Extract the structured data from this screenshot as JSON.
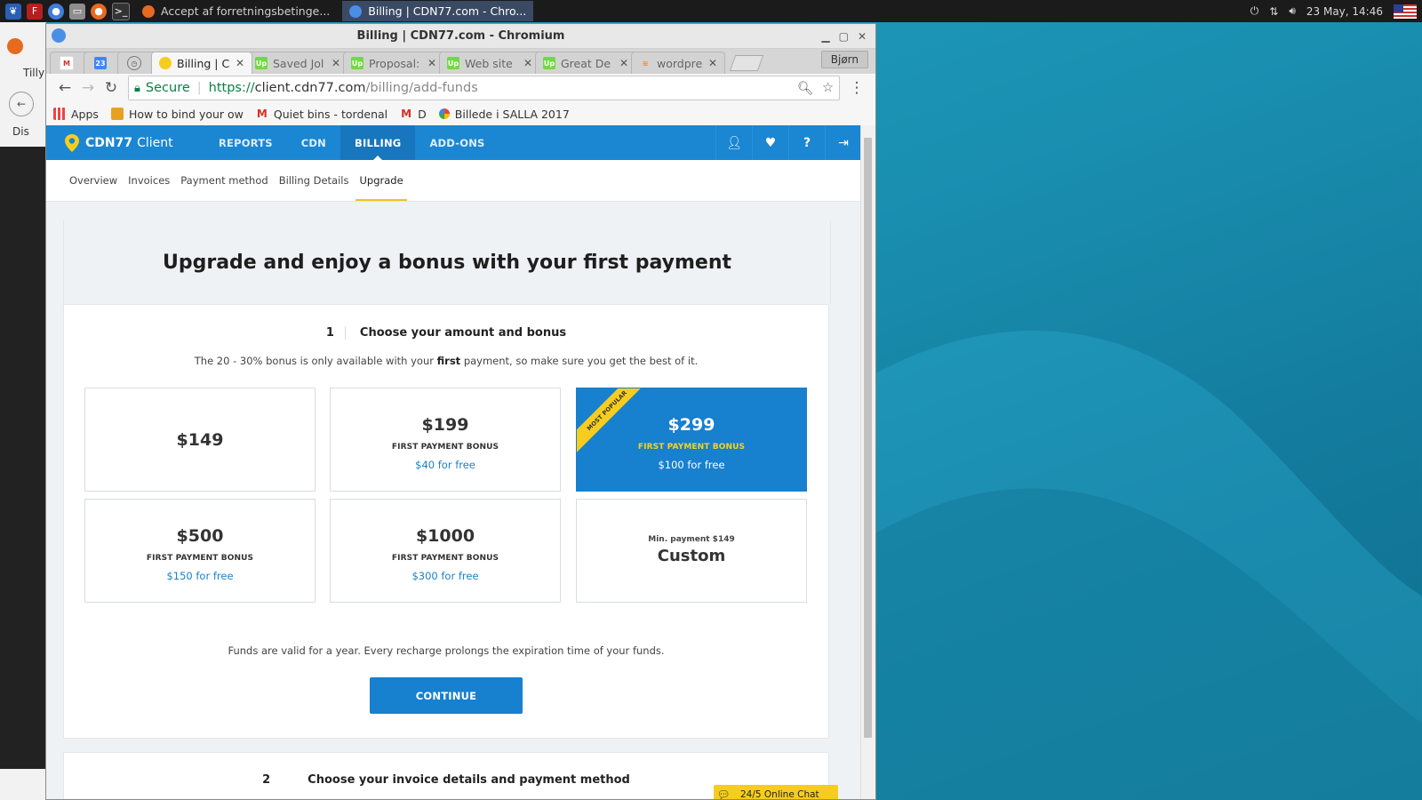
{
  "taskbar": {
    "tasks": [
      {
        "label": "Accept af forretningsbetinge...",
        "active": false
      },
      {
        "label": "Billing | CDN77.com - Chro...",
        "active": true
      }
    ],
    "clock": "23 May, 14:46"
  },
  "behind_window": {
    "text1": "Tilly",
    "text2": "Dis"
  },
  "browser": {
    "window_title": "Billing | CDN77.com - Chromium",
    "tabs": [
      {
        "label": "",
        "icon": "gmail-icon"
      },
      {
        "label": "",
        "icon": "calendar-icon",
        "badge": "23"
      },
      {
        "label": "",
        "icon": "history-icon"
      },
      {
        "label": "Billing | C",
        "icon": "cdn77-icon",
        "active": true
      },
      {
        "label": "Saved Jol",
        "icon": "upwork-icon"
      },
      {
        "label": "Proposal:",
        "icon": "upwork-icon"
      },
      {
        "label": "Web site",
        "icon": "upwork-icon"
      },
      {
        "label": "Great De",
        "icon": "upwork-icon"
      },
      {
        "label": "wordpres",
        "icon": "stackoverflow-icon"
      }
    ],
    "profile": "Bjørn",
    "address": {
      "secure_label": "Secure",
      "scheme": "https://",
      "host": "client.cdn77.com",
      "path": "/billing/add-funds"
    },
    "bookmarks": [
      {
        "label": "Apps",
        "icon": "apps-icon"
      },
      {
        "label": "How to bind your ow",
        "icon": "folder-user-icon"
      },
      {
        "label": "Quiet bins - tordenal",
        "icon": "gmail-icon"
      },
      {
        "label": "D",
        "icon": "gmail-icon"
      },
      {
        "label": "Billede i SALLA 2017",
        "icon": "photos-icon"
      }
    ]
  },
  "app": {
    "brand_bold": "CDN77",
    "brand_rest": "Client",
    "nav": [
      {
        "label": "REPORTS",
        "active": false
      },
      {
        "label": "CDN",
        "active": false
      },
      {
        "label": "BILLING",
        "active": true
      },
      {
        "label": "ADD-ONS",
        "active": false
      }
    ],
    "nav_icons": [
      "user-icon",
      "health-icon",
      "help-icon",
      "logout-icon"
    ],
    "subnav": [
      {
        "label": "Overview",
        "active": false
      },
      {
        "label": "Invoices",
        "active": false
      },
      {
        "label": "Payment method",
        "active": false
      },
      {
        "label": "Billing Details",
        "active": false
      },
      {
        "label": "Upgrade",
        "active": true
      }
    ]
  },
  "upgrade": {
    "heading": "Upgrade and enjoy a bonus with your first payment",
    "step1": {
      "number": "1",
      "title": "Choose your amount and bonus",
      "desc_before": "The 20 - 30% bonus is only available with your ",
      "desc_bold": "first",
      "desc_after": " payment, so make sure you get the best of it."
    },
    "cards": [
      {
        "amount": "$149",
        "bonus_label": "",
        "bonus": ""
      },
      {
        "amount": "$199",
        "bonus_label": "FIRST PAYMENT BONUS",
        "bonus": "$40 for free"
      },
      {
        "amount": "$299",
        "bonus_label": "FIRST PAYMENT BONUS",
        "bonus": "$100 for free",
        "ribbon": "MOST POPULAR",
        "selected": true
      },
      {
        "amount": "$500",
        "bonus_label": "FIRST PAYMENT BONUS",
        "bonus": "$150 for free"
      },
      {
        "amount": "$1000",
        "bonus_label": "FIRST PAYMENT BONUS",
        "bonus": "$300 for free"
      }
    ],
    "custom_card": {
      "min_label": "Min. payment $149",
      "label": "Custom"
    },
    "validity": "Funds are valid for a year. Every recharge prolongs the expiration time of your funds.",
    "continue_label": "CONTINUE",
    "step2": {
      "number": "2",
      "title": "Choose your invoice details and payment method"
    }
  },
  "chat": {
    "label": "24/5 Online Chat"
  },
  "colors": {
    "brand_blue": "#1b86d1",
    "selected_card": "#1780cf",
    "accent_yellow": "#f6cd1e",
    "desktop": "#1a8fb0"
  }
}
